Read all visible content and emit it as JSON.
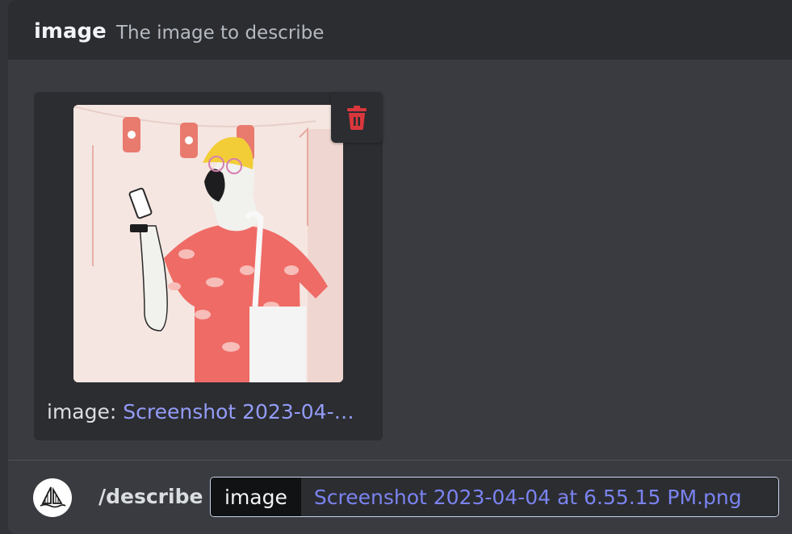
{
  "option": {
    "name": "image",
    "description": "The image to describe"
  },
  "upload": {
    "label": "image: ",
    "filename_truncated": "Screenshot 2023-04-…",
    "delete_icon": "trash-icon",
    "preview_icon": "illustration-person-with-phone"
  },
  "command": {
    "bot_avatar_icon": "sailboat-logo-icon",
    "name": "/describe",
    "arg_name": "image",
    "arg_value": "Screenshot 2023-04-04 at 6.55.15 PM.png"
  },
  "colors": {
    "background": "#313338",
    "panel": "#393b40",
    "header": "#2b2d31",
    "link": "#949cf7",
    "danger": "#da373c"
  }
}
